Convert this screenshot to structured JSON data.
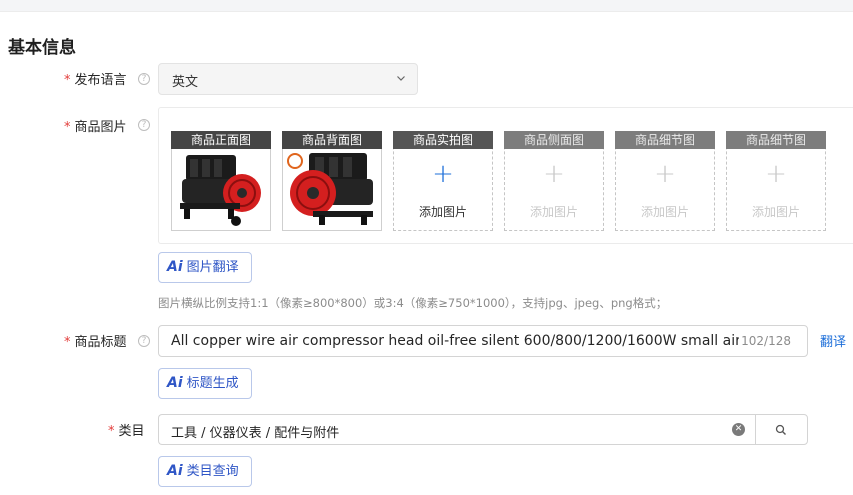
{
  "section": {
    "title": "基本信息"
  },
  "colors": {
    "required": "#e23c39",
    "link": "#1e6fd9",
    "ai_button": "#2f56c6"
  },
  "language": {
    "label": "发布语言",
    "value": "英文",
    "help_icon": "question-circle-icon",
    "chevron_icon": "chevron-down-icon"
  },
  "images": {
    "label": "商品图片",
    "help_icon": "question-circle-icon",
    "slots": [
      {
        "title": "商品正面图",
        "state": "filled",
        "image": "air-compressor-front-photo"
      },
      {
        "title": "商品背面图",
        "state": "filled",
        "image": "air-compressor-back-photo"
      },
      {
        "title": "商品实拍图",
        "state": "empty",
        "plus": "+",
        "add_label": "添加图片"
      },
      {
        "title": "商品侧面图",
        "state": "disabled",
        "plus": "+",
        "add_label": "添加图片"
      },
      {
        "title": "商品细节图",
        "state": "disabled",
        "plus": "+",
        "add_label": "添加图片"
      },
      {
        "title": "商品细节图",
        "state": "disabled",
        "plus": "+",
        "add_label": "添加图片"
      }
    ],
    "translate_button": {
      "ai_mark": "Ai",
      "label": "图片翻译"
    },
    "hint": "图片横纵比例支持1:1（像素≥800*800）或3:4（像素≥750*1000），支持jpg、jpeg、png格式；"
  },
  "product_title": {
    "label": "商品标题",
    "help_icon": "question-circle-icon",
    "value": "All copper wire air compressor head oil-free silent 600/800/1200/1600W small air pu",
    "count": "102/128",
    "translate_link": "翻译",
    "generate_button": {
      "ai_mark": "Ai",
      "label": "标题生成"
    }
  },
  "category": {
    "label": "类目",
    "value": "工具 / 仪器仪表 / 配件与附件",
    "clear_icon": "clear-circle-icon",
    "search_icon": "search-icon",
    "query_button": {
      "ai_mark": "Ai",
      "label": "类目查询"
    }
  }
}
